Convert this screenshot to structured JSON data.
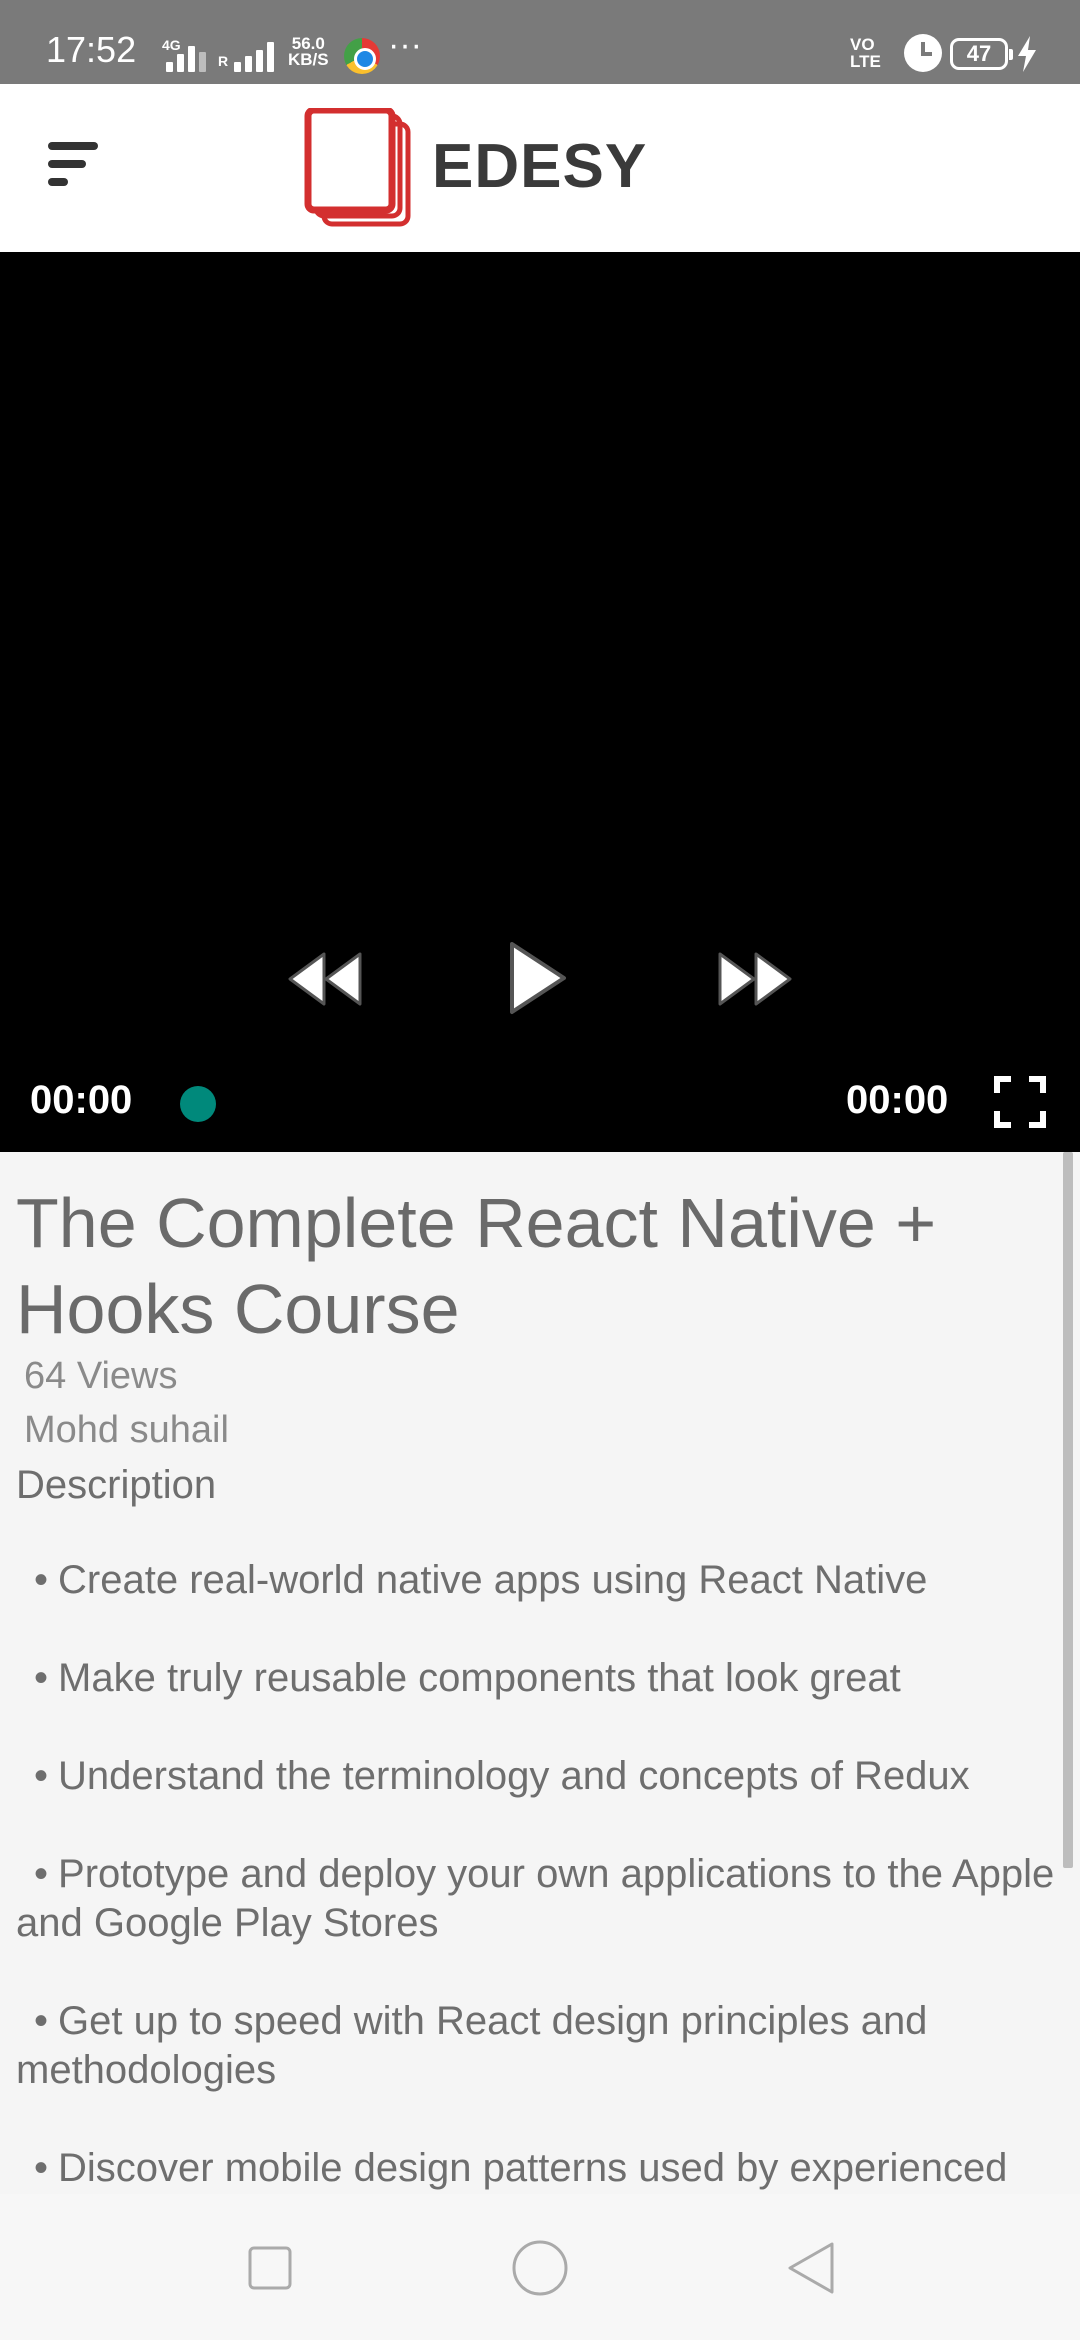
{
  "status_bar": {
    "time": "17:52",
    "network": "4G",
    "roaming": "R",
    "speed_value": "56.0",
    "speed_unit": "KB/S",
    "more": "···",
    "volte": "VO LTE",
    "battery": "47",
    "icons": [
      "signal-icon",
      "chrome-icon",
      "alarm-icon",
      "battery-icon",
      "charging-icon"
    ]
  },
  "header": {
    "logo_text": "EDESY",
    "icons": [
      "menu-icon",
      "logo-icon"
    ],
    "brand_color": "#d32f2f"
  },
  "player": {
    "current_time": "00:00",
    "duration": "00:00",
    "progress": 0,
    "icons": [
      "rewind-icon",
      "play-icon",
      "fast-forward-icon",
      "fullscreen-icon"
    ],
    "accent_color": "#00897b"
  },
  "course": {
    "title": "The Complete React Native + Hooks Course",
    "views": "64 Views",
    "author": "Mohd suhail",
    "description_label": "Description",
    "bullets": [
      "Create real-world native apps using React Native",
      "Make truly reusable components that look great",
      "Understand the terminology and concepts of Redux",
      "Prototype and deploy your own applications to the Apple and Google Play Stores",
      "Get up to speed with React design principles and methodologies",
      "Discover mobile design patterns used by experienced"
    ]
  },
  "nav": {
    "icons": [
      "recent-apps-icon",
      "home-icon",
      "back-icon"
    ]
  }
}
